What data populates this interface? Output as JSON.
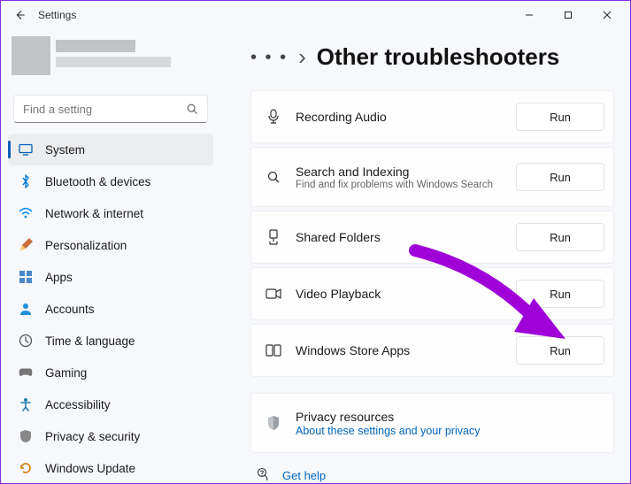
{
  "window": {
    "title": "Settings"
  },
  "search": {
    "placeholder": "Find a setting"
  },
  "nav": {
    "items": [
      {
        "label": "System"
      },
      {
        "label": "Bluetooth & devices"
      },
      {
        "label": "Network & internet"
      },
      {
        "label": "Personalization"
      },
      {
        "label": "Apps"
      },
      {
        "label": "Accounts"
      },
      {
        "label": "Time & language"
      },
      {
        "label": "Gaming"
      },
      {
        "label": "Accessibility"
      },
      {
        "label": "Privacy & security"
      },
      {
        "label": "Windows Update"
      }
    ],
    "selected_index": 0
  },
  "page": {
    "breadcrumb_ellipsis": "• • •",
    "breadcrumb_sep": "›",
    "title": "Other troubleshooters"
  },
  "troubleshooters": [
    {
      "title": "Recording Audio",
      "sub": "",
      "action": "Run"
    },
    {
      "title": "Search and Indexing",
      "sub": "Find and fix problems with Windows Search",
      "action": "Run"
    },
    {
      "title": "Shared Folders",
      "sub": "",
      "action": "Run"
    },
    {
      "title": "Video Playback",
      "sub": "",
      "action": "Run"
    },
    {
      "title": "Windows Store Apps",
      "sub": "",
      "action": "Run"
    }
  ],
  "privacy": {
    "title": "Privacy resources",
    "link": "About these settings and your privacy"
  },
  "help": {
    "label": "Get help"
  },
  "colors": {
    "accent": "#005fb8",
    "link": "#0067c0",
    "arrow": "#a000d8"
  }
}
